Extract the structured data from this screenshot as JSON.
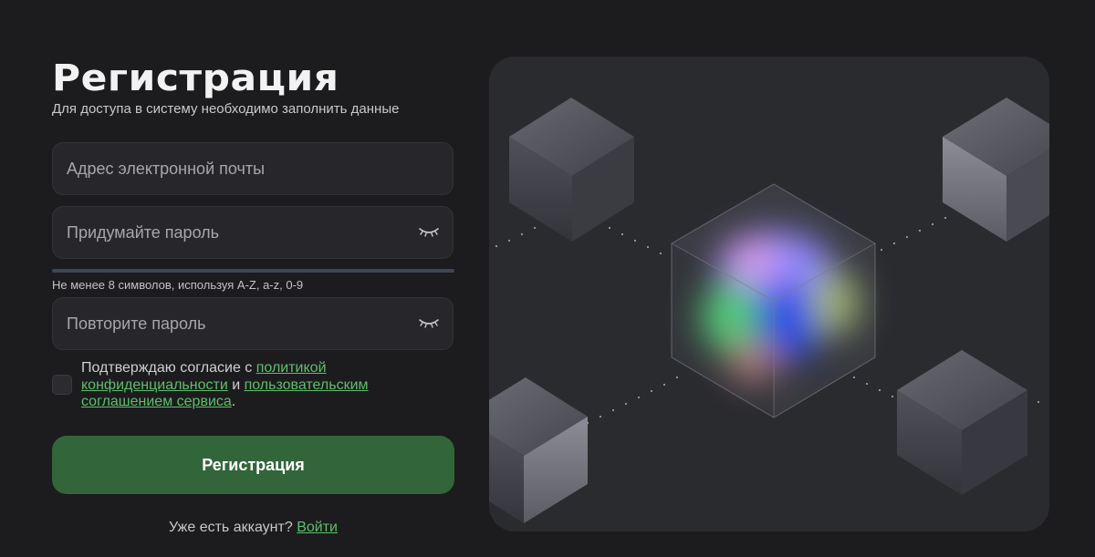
{
  "header": {
    "title": "Регистрация",
    "subtitle": "Для доступа в систему необходимо заполнить данные"
  },
  "form": {
    "email_placeholder": "Адрес электронной почты",
    "password_placeholder": "Придумайте пароль",
    "password_hint": "Не менее 8 символов, используя A-Z, a-z, 0-9",
    "repeat_placeholder": "Повторите пароль",
    "consent": {
      "prefix": "Подтверждаю согласие с ",
      "privacy_link": "политикой конфиденциальности",
      "middle": " и ",
      "terms_link": "пользовательским соглашением сервиса",
      "suffix": "."
    },
    "submit_label": "Регистрация",
    "login_prompt": "Уже есть аккаунт? ",
    "login_link": "Войти"
  },
  "icons": {
    "password_toggle": "eye-closed-icon",
    "repeat_toggle": "eye-closed-icon"
  },
  "colors": {
    "accent": "#5fbe6b",
    "button": "#33653a",
    "background": "#1c1c1e",
    "field": "#27272b"
  }
}
